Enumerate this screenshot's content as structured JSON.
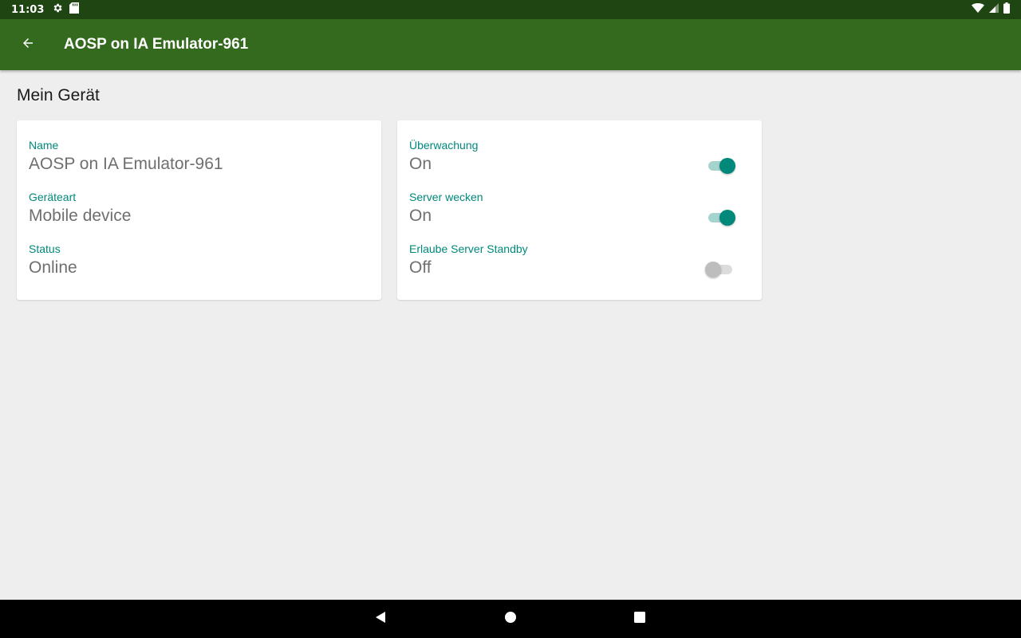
{
  "status_bar": {
    "time": "11:03",
    "left_icons": [
      "gear-icon",
      "sd-card-icon"
    ],
    "right_icons": [
      "wifi-icon",
      "signal-icon",
      "battery-icon"
    ]
  },
  "app_bar": {
    "title": "AOSP on IA Emulator-961",
    "background": "#346a1e"
  },
  "section": {
    "title": "Mein Gerät"
  },
  "device_info": {
    "fields": [
      {
        "label": "Name",
        "value": "AOSP on IA Emulator-961"
      },
      {
        "label": "Geräteart",
        "value": "Mobile device"
      },
      {
        "label": "Status",
        "value": "Online"
      }
    ]
  },
  "settings": {
    "fields": [
      {
        "label": "Überwachung",
        "value": "On",
        "enabled": true
      },
      {
        "label": "Server wecken",
        "value": "On",
        "enabled": true
      },
      {
        "label": "Erlaube Server Standby",
        "value": "Off",
        "enabled": false
      }
    ]
  },
  "colors": {
    "accent": "#00897b",
    "status_bar": "#1f4512"
  },
  "nav_bar": {
    "buttons": [
      "back-triangle-icon",
      "home-circle-icon",
      "recents-square-icon"
    ]
  }
}
